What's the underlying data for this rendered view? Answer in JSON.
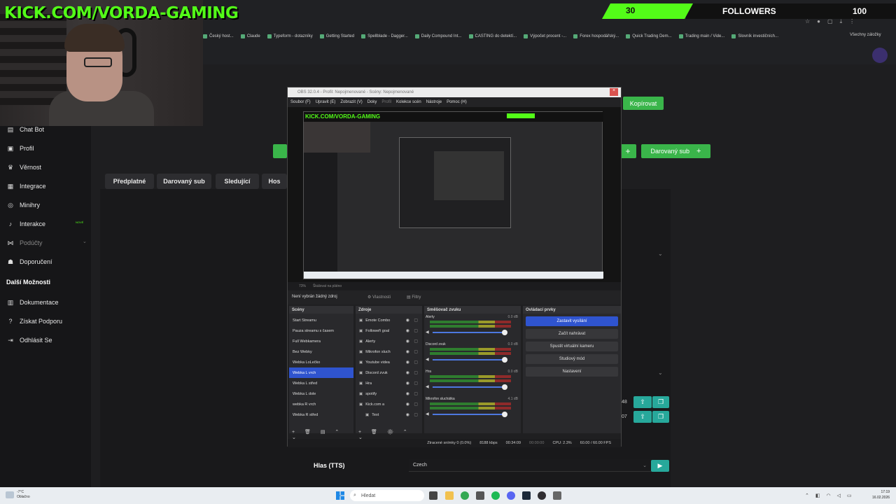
{
  "overlay": {
    "kick_text": "KICK.COM/VORDA-GAMING",
    "followers_current": "30",
    "followers_label": "FOLLOWERS",
    "followers_goal": "100"
  },
  "browser": {
    "bookmarks": [
      "Český host...",
      "Claude",
      "Typeform - dotazníky",
      "Getting Started",
      "Spellblade - Dagger...",
      "Daily Compound Int...",
      "CASTING do detektí...",
      "Výpočet procent -...",
      "Forex hospodářský...",
      "Quick Trading Dem...",
      "Trading main / Vide...",
      "Slovník investičních..."
    ],
    "all_bookmarks": "Všechny záložky"
  },
  "sidebar": {
    "items": [
      {
        "label": "Chat Bot",
        "icon": "chat-icon"
      },
      {
        "label": "Profil",
        "icon": "profile-icon"
      },
      {
        "label": "Věrnost",
        "icon": "trophy-icon"
      },
      {
        "label": "Integrace",
        "icon": "grid-icon"
      },
      {
        "label": "Minihry",
        "icon": "gamepad-icon"
      },
      {
        "label": "Interakce",
        "icon": "music-icon",
        "badge": "NOVÉ"
      },
      {
        "label": "Podúčty",
        "icon": "subaccount-icon"
      },
      {
        "label": "Doporučení",
        "icon": "referral-icon"
      }
    ],
    "section_title": "Další Možnosti",
    "more_items": [
      {
        "label": "Dokumentace",
        "icon": "document-icon"
      },
      {
        "label": "Získat Podporu",
        "icon": "help-icon"
      },
      {
        "label": "Odhlásit Se",
        "icon": "logout-icon"
      }
    ]
  },
  "main": {
    "tabs": [
      "Předplatné",
      "Darovaný sub",
      "Sledující",
      "Hos"
    ],
    "copy_button": "Kopírovat",
    "donated_sub_button": "Darovaný sub",
    "row_values": [
      "48",
      "07"
    ],
    "tts_label": "Hlas (TTS)",
    "tts_value": "Czech"
  },
  "obs": {
    "title": "OBS 32.0.4 - Profil: Nepojmenované - Scény: Nepojmenované",
    "menu": [
      "Soubor (F)",
      "Upravit (E)",
      "Zobrazit (V)",
      "Doky",
      "Profil",
      "Kolekce scén",
      "Nástroje",
      "Pomoc (H)"
    ],
    "zoom": "73%",
    "zoom_mode": "Škálovat na plátno",
    "no_source": "Není vybrán žádný zdroj",
    "properties": "Vlastnosti",
    "filters": "Filtry",
    "scenes_title": "Scény",
    "scenes": [
      "Start Streamu",
      "Pauza streamu s časem",
      "Full Webkamera",
      "Bez Webky",
      "Webka LoLečko",
      "Webka L vrch",
      "Webka L střed",
      "Webka L dole",
      "webka R vrch",
      "Webka R střed"
    ],
    "selected_scene": 5,
    "sources_title": "Zdroje",
    "sources": [
      "Emote Combo",
      "Followeři goal",
      "Alerty",
      "Mikrofon sluch",
      "Youtube videa",
      "Discord zvuk",
      "Hra",
      "spotify",
      "Kick.com a",
      "Text"
    ],
    "mixer_title": "Směšovač zvuku",
    "mixer": [
      {
        "name": "Alerty",
        "db": "0.0 dB",
        "level": 0.92
      },
      {
        "name": "Discord zvuk",
        "db": "0.0 dB",
        "level": 0.92
      },
      {
        "name": "Hra",
        "db": "0.0 dB",
        "level": 0.92
      },
      {
        "name": "Mikrofon sluchátka",
        "db": "4.1 dB",
        "level": 0.92
      }
    ],
    "controls_title": "Ovládací prvky",
    "controls": [
      "Zastavit vysílání",
      "Začít nahrávat",
      "Spustit virtuální kameru",
      "Studiový mód",
      "Nastavení"
    ],
    "status": {
      "dropped": "Ztracené snímky 0 (0.0%)",
      "bitrate": "8188 kbps",
      "live_time": "00:34:09",
      "rec_time": "00:00:00",
      "cpu": "CPU: 2.3%",
      "fps": "60.00 / 60.00 FPS"
    }
  },
  "taskbar": {
    "weather_temp": "-7°C",
    "weather_desc": "Oblačno",
    "search_placeholder": "Hledat",
    "time": "17:19",
    "date": "16.02.2026"
  }
}
